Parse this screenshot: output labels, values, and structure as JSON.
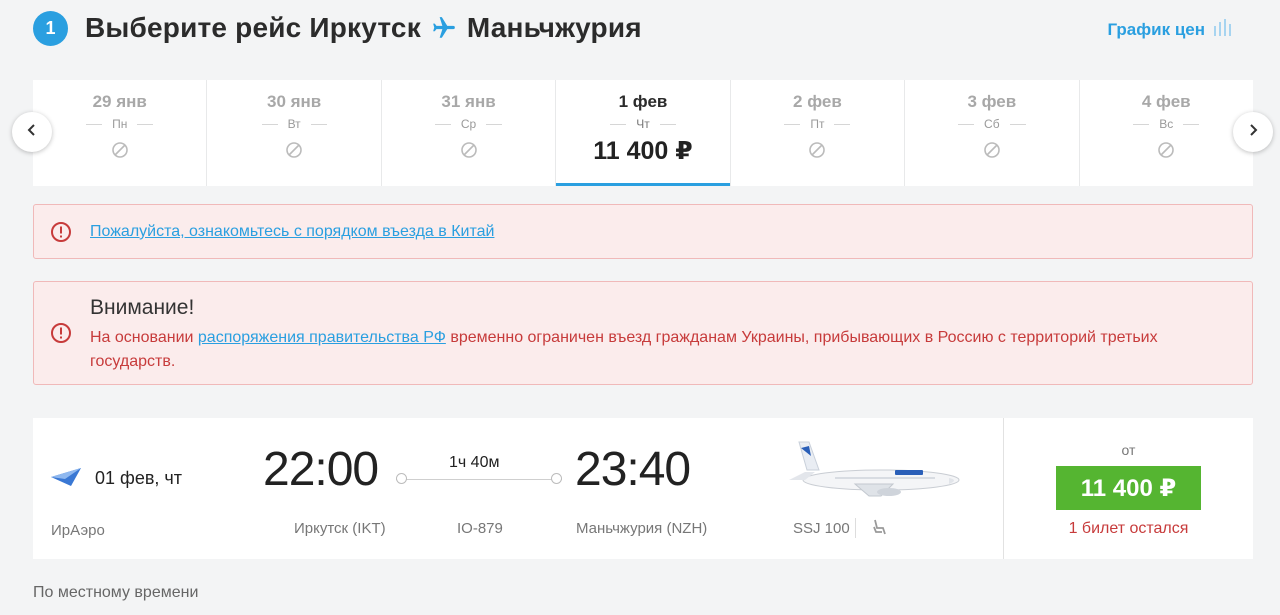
{
  "header": {
    "step": "1",
    "title_prefix": "Выберите рейс Иркутск",
    "title_dest": "Маньчжурия",
    "price_chart": "График цен"
  },
  "dates": [
    {
      "date": "29 янв",
      "weekday": "Пн"
    },
    {
      "date": "30 янв",
      "weekday": "Вт"
    },
    {
      "date": "31 янв",
      "weekday": "Ср"
    },
    {
      "date": "1 фев",
      "weekday": "Чт",
      "price": "11 400 ₽",
      "active": true
    },
    {
      "date": "2 фев",
      "weekday": "Пт"
    },
    {
      "date": "3 фев",
      "weekday": "Сб"
    },
    {
      "date": "4 фев",
      "weekday": "Вс"
    }
  ],
  "alerts": {
    "china_link": "Пожалуйста, ознакомьтесь с порядком въезда в Китай",
    "warning_title": "Внимание!",
    "warning_pre": "На основании ",
    "warning_link": "распоряжения правительства РФ",
    "warning_post": " временно ограничен въезд гражданам Украины, прибывающих в Россию с территорий третьих государств."
  },
  "flight": {
    "date": "01 фев, чт",
    "airline": "ИрАэро",
    "dep_time": "22:00",
    "dep_city": "Иркутск (IKT)",
    "duration": "1ч 40м",
    "flight_no": "IO-879",
    "arr_time": "23:40",
    "arr_city": "Маньчжурия (NZH)",
    "aircraft": "SSJ 100",
    "price_from": "от",
    "price": "11 400 ₽",
    "tickets_left": "1 билет остался"
  },
  "footer": {
    "local_time": "По местному времени"
  },
  "colors": {
    "accent": "#2a9fe0",
    "buy": "#55b531",
    "alert_text": "#c73b3b",
    "alert_bg": "#fbecec"
  }
}
